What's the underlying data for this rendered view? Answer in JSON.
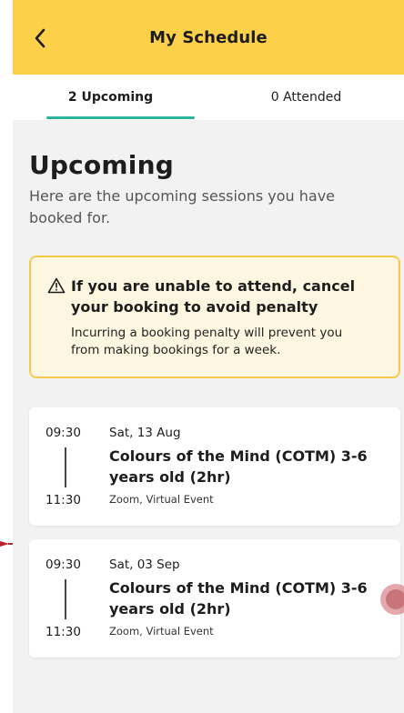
{
  "header": {
    "title": "My Schedule",
    "back_icon": "back-arrow-icon"
  },
  "tabs": [
    {
      "label": "2 Upcoming",
      "active": true
    },
    {
      "label": "0 Attended",
      "active": false
    }
  ],
  "section": {
    "title": "Upcoming",
    "subtitle": "Here are the upcoming sessions you have booked for."
  },
  "warning": {
    "icon": "warning-triangle-icon",
    "title": "If you are unable to attend, cancel your booking to avoid penalty",
    "body": "Incurring a booking penalty will prevent you from making bookings for a week."
  },
  "sessions": [
    {
      "start": "09:30",
      "end": "11:30",
      "date": "Sat, 13 Aug",
      "title": "Colours of the Mind (COTM) 3-6 years old (2hr)",
      "location": "Zoom, Virtual Event"
    },
    {
      "start": "09:30",
      "end": "11:30",
      "date": "Sat, 03 Sep",
      "title": "Colours of the Mind (COTM) 3-6 years old (2hr)",
      "location": "Zoom, Virtual Event"
    }
  ],
  "colors": {
    "header_bg": "#fdd04a",
    "tab_indicator": "#2cb39a",
    "warning_border": "#f6c94a",
    "warning_bg": "#fdf7e1",
    "touch_indicator": "#c97479"
  }
}
